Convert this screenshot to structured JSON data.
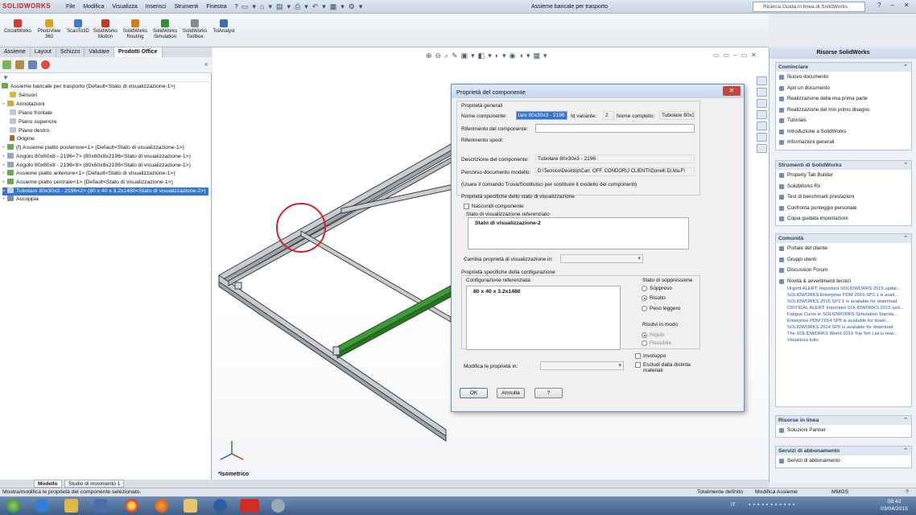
{
  "app": {
    "logo": "SOLIDWORKS",
    "menu": [
      "File",
      "Modifica",
      "Visualizza",
      "Inserisci",
      "Strumenti",
      "Finestra",
      "?"
    ],
    "doc_title": "Assieme bancale per trasporto",
    "search_placeholder": "Ricerca Guida in linea di SolidWorks"
  },
  "command_manager": [
    {
      "label": "CircuitWorks",
      "color": "#d93a2b"
    },
    {
      "label": "PhotoView 360",
      "color": "#e0a020"
    },
    {
      "label": "ScanTo3D",
      "color": "#3d7cc9"
    },
    {
      "label": "SolidWorks Motion",
      "color": "#c0392b"
    },
    {
      "label": "SolidWorks Routing",
      "color": "#d47f1a"
    },
    {
      "label": "SolidWorks Simulation",
      "color": "#2f8f3a"
    },
    {
      "label": "SolidWorks Toolbox",
      "color": "#8b8b8b"
    },
    {
      "label": "TolAnalyst",
      "color": "#3f6fb5"
    }
  ],
  "cmd_tabs": [
    "Assieme",
    "Layout",
    "Schizzo",
    "Valutare",
    "Prodotti Office"
  ],
  "cmd_tab_active": 4,
  "tree": {
    "root": "Assieme bancale per trasporto  (Default<Stato di visualizzazione-1>)",
    "items": [
      {
        "label": "Sensori",
        "color": "#e3b341",
        "indent": 1
      },
      {
        "label": "Annotazioni",
        "color": "#d9a43a",
        "indent": 1
      },
      {
        "label": "Piano frontale",
        "color": "#b9c7d8",
        "indent": 1
      },
      {
        "label": "Piano superiore",
        "color": "#b9c7d8",
        "indent": 1
      },
      {
        "label": "Piano destro",
        "color": "#b9c7d8",
        "indent": 1
      },
      {
        "label": "Origine",
        "color": "#c05a2a",
        "indent": 1
      },
      {
        "label": "(f) Assieme piatto posteriore<1> (Default<Stato di visualizzazione-1>)",
        "color": "#6aa84f",
        "indent": 1
      },
      {
        "label": "Angolo 80x60x8 - 2196<7> (80x60x8x2196<Stato di visualizzazione-1>)",
        "color": "#9aa6b4",
        "indent": 1
      },
      {
        "label": "Angolo 80x60x8 - 2196<8> (80x60x8x2196<Stato di visualizzazione-1>)",
        "color": "#9aa6b4",
        "indent": 1
      },
      {
        "label": "Assieme piatto anteriore<1> (Default<Stato di visualizzazione-1>)",
        "color": "#6aa84f",
        "indent": 1
      },
      {
        "label": "Assieme piatto centrale<1> (Default<Stato di visualizzazione-1>)",
        "color": "#6aa84f",
        "indent": 1
      },
      {
        "label": "Tubolare 80x30x3 - 2196<2> (80 x 40 x 3.2x1480<Stato di visualizzazione-2>)",
        "color": "#9aa6b4",
        "indent": 1,
        "selected": true
      },
      {
        "label": "Accoppia",
        "color": "#7d8fa6",
        "indent": 1
      }
    ]
  },
  "viewport": {
    "view_label": "*Isometrico"
  },
  "dialog": {
    "title": "Proprietà del componente",
    "sec_general": "Proprietà generali",
    "lbl_name": "Nome componente:",
    "val_name": "lare 80x30x3 - 2196",
    "lbl_variant": "Id variante:",
    "val_variant": "2",
    "lbl_fullname": "Nome completo:",
    "val_fullname": "Tubolare 80x3",
    "lbl_ref": "Riferimento del componente:",
    "lbl_spool": "Riferimento spool:",
    "lbl_desc": "Descrizione del componente:",
    "val_desc": "Tubolare 80x30x3 - 2196",
    "lbl_path": "Percorso documento modello:",
    "val_path": "D:\\Tecnico\\Desktop\\Carr. OFF. CONDOR\\J CLIENTI\\Donelli Di.Ma.F\\",
    "note_path": "(Usare il comando Trova/Sostituisci per sostituire il modello dei componenti)",
    "sec_display": "Proprietà specifiche dello stato di visualizzazione",
    "chk_hide": "Nascondi componente",
    "lbl_display_ref": "Stato di visualizzazione referenziato",
    "display_state": "Stato di visualizzazione-2",
    "lbl_change_display": "Cambia proprietà di visualizzazione in:",
    "sec_config": "Proprietà specifiche della configurazione",
    "lbl_config_ref": "Configurazione referenziata",
    "config": "80 x 40 x 3.2x1480",
    "lbl_suppression": "Stato di soppressione",
    "rad_suppressed": "Soppreso",
    "rad_resolved": "Risolto",
    "rad_lightweight": "Peso leggero",
    "lbl_solve": "Risolvi in modo",
    "rad_rigid": "Rigido",
    "rad_flexible": "Flessibile",
    "lbl_modify": "Modifica le proprietà in:",
    "chk_envelope": "Involuppo",
    "chk_exclude": "Escludi dalla distinta materiali",
    "btn_ok": "OK",
    "btn_cancel": "Annulla",
    "btn_help": "?"
  },
  "taskpane": {
    "title": "Risorse SolidWorks",
    "sections": [
      {
        "title": "Cominciare",
        "links": [
          "Nuovo documento",
          "Apri un documento",
          "Realizzazione della mia prima parte",
          "Realizzazione del mio primo disegno",
          "Tutorials",
          "Introduzione a SolidWorks",
          "Informazioni generali"
        ]
      },
      {
        "title": "Strumenti di SolidWorks",
        "links": [
          "Property Tab Builder",
          "SolidWorks Rx",
          "Test di benchmark prestazioni",
          "Confronta punteggio personale",
          "Copia guidata impostazioni"
        ]
      },
      {
        "title": "Comunità",
        "links": [
          "Portale del cliente",
          "Gruppi utenti",
          "Discussion Forum",
          "Novità & avvertimenti tecnici"
        ]
      },
      {
        "title": "Risorse in linea",
        "links": [
          "Soluzioni Partner"
        ]
      },
      {
        "title": "Servizi di abbonamento",
        "links": [
          "Servizi di abbonamento"
        ]
      }
    ],
    "news": [
      "Urgent ALERT: Important SOLIDWORKS 2015 updat...",
      "SOLIDWORKS Enterprise PDM 2015 SP2.1 is avail...",
      "SOLIDWORKS 2015 SP2.1 is available for download",
      "CRITICAL ALERT: Important SOLIDWORKS 2015 upd...",
      "Fatigue Curve in SOLIDWORKS Simulation Standa...",
      "Enterprise PDM 2014 SP5 is available for down...",
      "SOLIDWORKS 2014 SP5 is available for download",
      "The SOLIDWORKS World 2015 Top Ten List is now...",
      "Visualizza tutto"
    ]
  },
  "bottom_tabs": [
    "Modello",
    "Studio di movimento 1"
  ],
  "status": {
    "left": "Mostra/modifica le proprietà del componente selezionato.",
    "defined": "Totalmente definito",
    "mode": "Modifica Assieme",
    "units": "MMGS",
    "help": "?"
  },
  "taskbar": {
    "lang": "IT",
    "time": "08:42",
    "date": "03/04/2015"
  }
}
